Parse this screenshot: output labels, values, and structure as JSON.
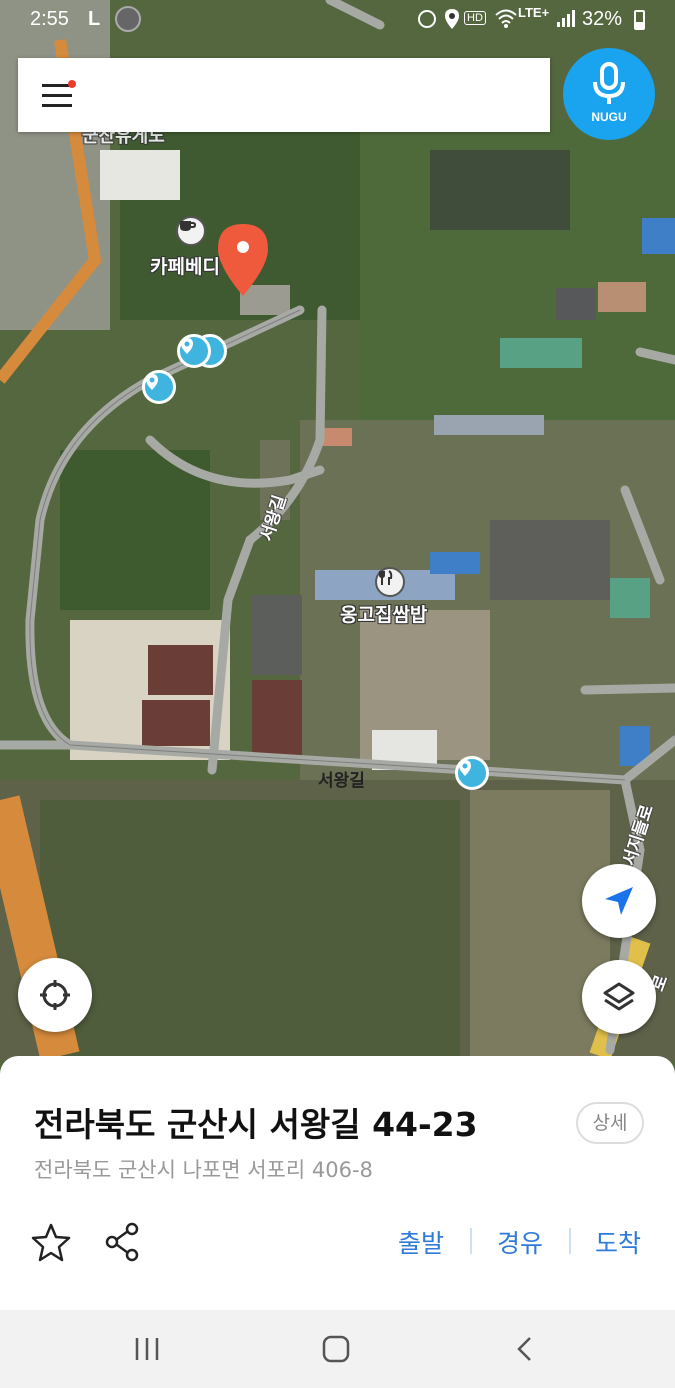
{
  "status_bar": {
    "time": "2:55",
    "battery": "32%",
    "network": "LTE+",
    "icons": [
      "alarm-icon",
      "location-icon",
      "hd-icon",
      "wifi-icon",
      "signal-icon",
      "battery-icon"
    ]
  },
  "search_bar": {
    "menu_icon": "hamburger-menu-icon",
    "has_notification_dot": true,
    "voice_button_label": "NUGU"
  },
  "map": {
    "labels": {
      "top_cut": "군산유게도",
      "cafe": "카페베디",
      "restaurant": "옹고집쌈밥",
      "road_vertical": "서왕길",
      "road_horizontal": "서왕길",
      "road_right": "서지들로",
      "road_far_right": "로"
    },
    "selected_pin_color": "#ef5a3c",
    "poi_pin_color": "#3fb4de"
  },
  "floating_buttons": {
    "locate": "crosshair-icon",
    "navigate": "navigation-arrow-icon",
    "layers": "layers-icon"
  },
  "place_sheet": {
    "address_main": "전라북도 군산시 서왕길 44-23",
    "address_sub": "전라북도 군산시 나포면 서포리 406-8",
    "detail_button": "상세",
    "actions": {
      "favorite": "star-icon",
      "share": "share-icon",
      "departure": "출발",
      "waypoint": "경유",
      "arrival": "도착"
    },
    "action_color": "#2f7bd9"
  },
  "nav_bar": {
    "recent": "recent-apps-icon",
    "home": "home-icon",
    "back": "back-icon"
  }
}
